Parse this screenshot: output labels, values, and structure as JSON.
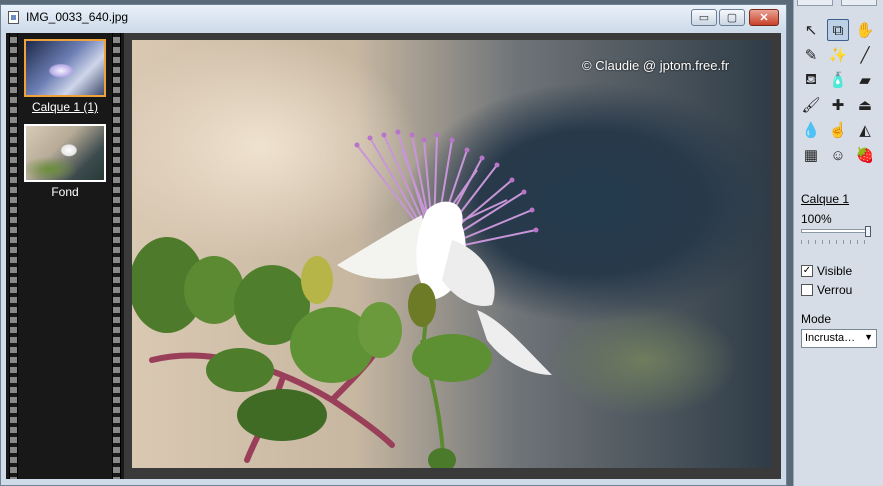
{
  "window": {
    "title": "IMG_0033_640.jpg",
    "buttons": {
      "minimize": "▭",
      "maximize": "▢",
      "close": "✕"
    }
  },
  "layers": [
    {
      "label": "Calque 1 (1)",
      "selected": true
    },
    {
      "label": "Fond",
      "selected": false
    }
  ],
  "canvas": {
    "copyright": "© Claudie @ jptom.free.fr"
  },
  "palette": {
    "tools": [
      {
        "name": "select-arrow-icon",
        "glyph": "↖"
      },
      {
        "name": "move-layer-icon",
        "glyph": "⧉",
        "active": true
      },
      {
        "name": "hand-pan-icon",
        "glyph": "✋"
      },
      {
        "name": "eyedropper-icon",
        "glyph": "✎"
      },
      {
        "name": "magic-wand-icon",
        "glyph": "✨"
      },
      {
        "name": "line-icon",
        "glyph": "╱"
      },
      {
        "name": "fill-bucket-icon",
        "glyph": "⛾"
      },
      {
        "name": "spray-icon",
        "glyph": "🧴"
      },
      {
        "name": "eraser-icon",
        "glyph": "▰"
      },
      {
        "name": "paintbrush-icon",
        "glyph": "🖌"
      },
      {
        "name": "clone-brush-icon",
        "glyph": "✚"
      },
      {
        "name": "stamp-icon",
        "glyph": "⏏"
      },
      {
        "name": "water-drop-icon",
        "glyph": "💧"
      },
      {
        "name": "smudge-icon",
        "glyph": "☝"
      },
      {
        "name": "gradient-brush-icon",
        "glyph": "◭"
      },
      {
        "name": "grid-warp-icon",
        "glyph": "▦"
      },
      {
        "name": "portrait-icon",
        "glyph": "☺"
      },
      {
        "name": "strawberry-icon",
        "glyph": "🍓"
      }
    ],
    "layer_name": "Calque 1",
    "opacity": "100%",
    "opacity_value": 100,
    "visible_label": "Visible",
    "visible_checked": true,
    "lock_label": "Verrou",
    "lock_checked": false,
    "mode_label": "Mode",
    "mode_value": "Incrusta…",
    "select_arrow": "▼"
  },
  "colors": {
    "selection_border": "#f0a23a",
    "close_button": "#c8412a"
  }
}
